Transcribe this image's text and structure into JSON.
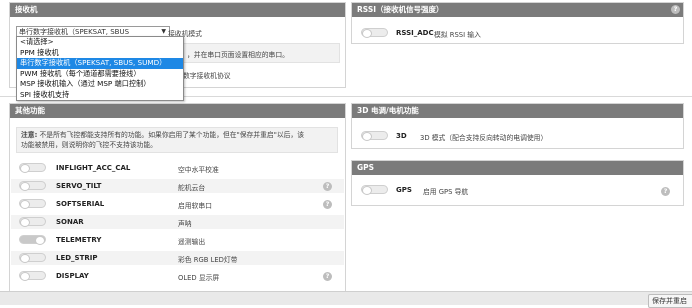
{
  "receiver": {
    "title": "接收机",
    "select_value": "串行数字接收机（SPEKSAT, SBUS",
    "mode_label": "接收机模式",
    "note_fragment": "，并在串口页面设置相应的串口。",
    "protocol_fragment": "数字接收机协议",
    "options": [
      "<请选择>",
      "PPM 接收机",
      "串行数字接收机（SPEKSAT, SBUS, SUMD）",
      "PWM 接收机（每个通道都需要接线）",
      "MSP 接收机输入（通过 MSP 端口控制）",
      "SPI 接收机支持"
    ],
    "selected_index": 2
  },
  "rssi": {
    "title": "RSSI（接收机信号强度）",
    "feature": {
      "name": "RSSI_ADC",
      "desc": "模拟 RSSI 输入",
      "on": false
    }
  },
  "other": {
    "title": "其他功能",
    "note_bold": "注意:",
    "note_line1": " 不是所有飞控都能支持所有的功能。如果你启用了某个功能，但在\"保存并重启\"以后，该",
    "note_line2": "功能被禁用，则说明你的飞控不支持该功能。",
    "features": [
      {
        "name": "INFLIGHT_ACC_CAL",
        "desc": "空中水平校准",
        "on": false,
        "help": false
      },
      {
        "name": "SERVO_TILT",
        "desc": "舵机云台",
        "on": false,
        "help": true
      },
      {
        "name": "SOFTSERIAL",
        "desc": "启用软串口",
        "on": false,
        "help": true
      },
      {
        "name": "SONAR",
        "desc": "声呐",
        "on": false,
        "help": false
      },
      {
        "name": "TELEMETRY",
        "desc": "遥测输出",
        "on": true,
        "help": false
      },
      {
        "name": "LED_STRIP",
        "desc": "彩色 RGB LED灯带",
        "on": false,
        "help": false
      },
      {
        "name": "DISPLAY",
        "desc": "OLED 显示屏",
        "on": false,
        "help": true
      }
    ]
  },
  "esc3d": {
    "title": "3D 电调/电机功能",
    "feature": {
      "name": "3D",
      "desc": "3D 模式（配合支持反向转动的电调使用）",
      "on": false
    }
  },
  "gps": {
    "title": "GPS",
    "feature": {
      "name": "GPS",
      "desc": "启用 GPS 导航",
      "on": false
    }
  },
  "footer": {
    "save_label": "保存并重启"
  }
}
